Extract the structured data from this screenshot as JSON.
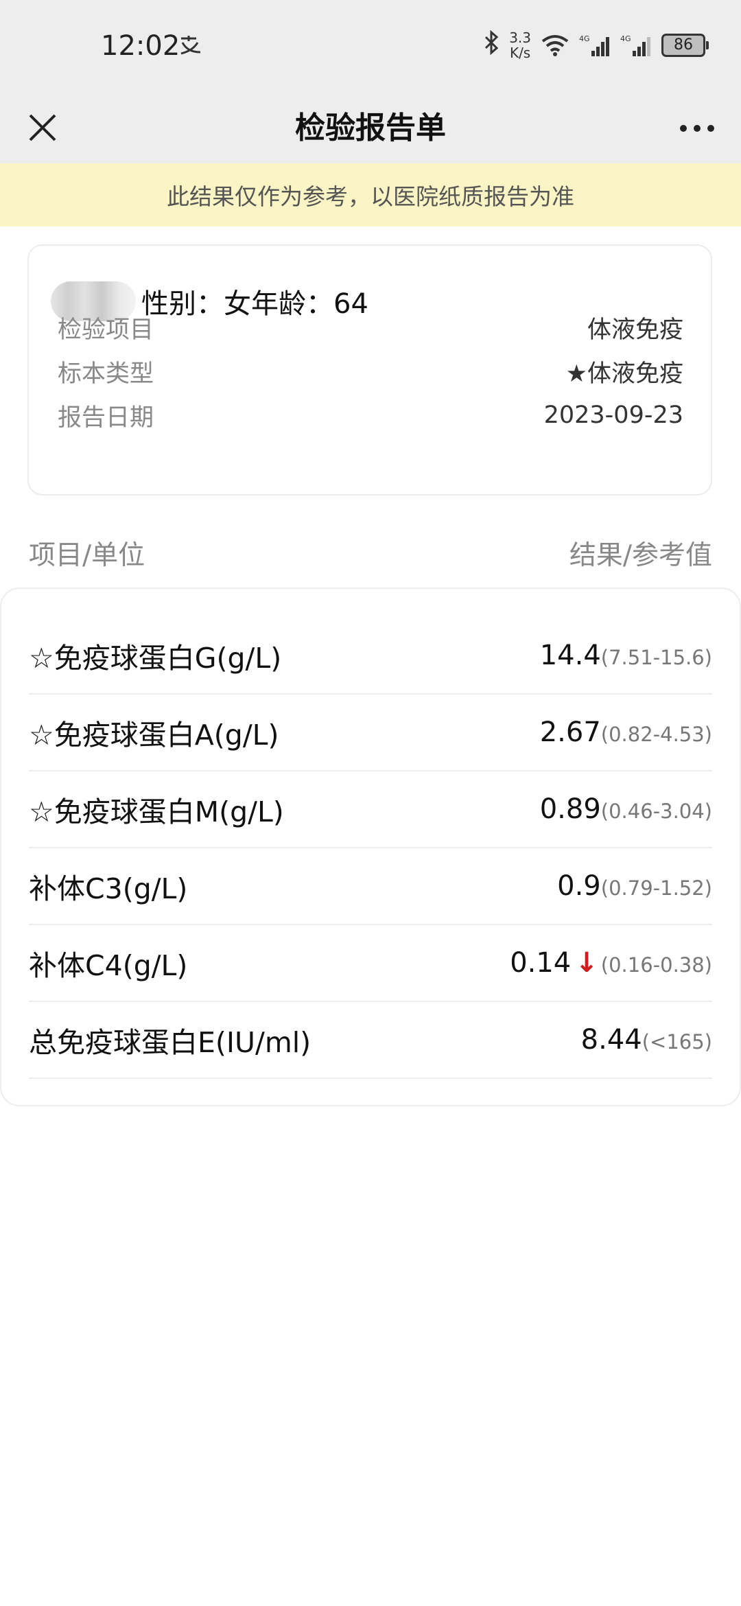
{
  "status_bar": {
    "time": "12:02",
    "net_speed_value": "3.3",
    "net_speed_unit": "K/s",
    "signal_1_label": "4G",
    "signal_2_label": "4G",
    "battery": "86"
  },
  "nav": {
    "title": "检验报告单"
  },
  "notice": "此结果仅作为参考，以医院纸质报告为准",
  "patient": {
    "summary": "性别：女年龄：64",
    "rows": [
      {
        "label": "检验项目",
        "value": "体液免疫"
      },
      {
        "label": "标本类型",
        "value": "★体液免疫"
      },
      {
        "label": "报告日期",
        "value": "2023-09-23"
      }
    ]
  },
  "list_header": {
    "left": "项目/单位",
    "right": "结果/参考值"
  },
  "results": [
    {
      "name": "☆免疫球蛋白G(g/L)",
      "result": "14.4",
      "flag": "",
      "ref": "(7.51-15.6)"
    },
    {
      "name": "☆免疫球蛋白A(g/L)",
      "result": "2.67",
      "flag": "",
      "ref": "(0.82-4.53)"
    },
    {
      "name": "☆免疫球蛋白M(g/L)",
      "result": "0.89",
      "flag": "",
      "ref": "(0.46-3.04)"
    },
    {
      "name": "补体C3(g/L)",
      "result": "0.9",
      "flag": "",
      "ref": "(0.79-1.52)"
    },
    {
      "name": "补体C4(g/L)",
      "result": "0.14",
      "flag": "↓",
      "ref": "(0.16-0.38)"
    },
    {
      "name": "总免疫球蛋白E(IU/ml)",
      "result": "8.44",
      "flag": "",
      "ref": "(<165)"
    }
  ],
  "colors": {
    "bar_bg": "#ededed",
    "notice_bg": "#fbf4c4",
    "low_flag": "#d21c1c"
  }
}
